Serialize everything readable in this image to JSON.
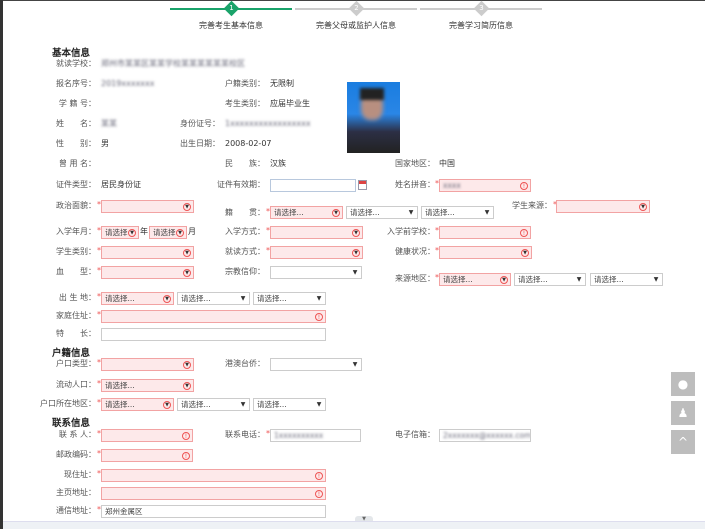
{
  "steps": [
    {
      "num": "1",
      "label": "完善考生基本信息",
      "active": true
    },
    {
      "num": "2",
      "label": "完善父母或监护人信息",
      "active": false
    },
    {
      "num": "3",
      "label": "完善学习简历信息",
      "active": false
    }
  ],
  "sections": {
    "basic": "基本信息",
    "household": "户籍信息",
    "contact": "联系信息"
  },
  "basic": {
    "school_label": "就读学校：",
    "school": "郑州市某某区某某学校某某某某某某校区",
    "reg_no_label": "报名序号：",
    "reg_no": "2019xxxxxxx",
    "hukou_type_label": "户籍类别：",
    "hukou_type": "无限制",
    "student_no_label": "学 籍 号：",
    "exam_type_label": "考生类别：",
    "exam_type": "应届毕业生",
    "name_label": "姓　　名：",
    "name": "某某",
    "id_label": "身份证号：",
    "id": "1xxxxxxxxxxxxxxxxx",
    "gender_label": "性　　别：",
    "gender": "男",
    "birth_label": "出生日期：",
    "birth": "2008-02-07",
    "former_name_label": "曾 用 名：",
    "ethnic_label": "民　　族：",
    "ethnic": "汉族",
    "country_label": "国家地区：",
    "country": "中国",
    "cert_type_label": "证件类型：",
    "cert_type": "居民身份证",
    "cert_valid_label": "证件有效期：",
    "pinyin_label": "姓名拼音：",
    "pinyin": "xxxx",
    "political_label": "政治面貌：",
    "native_label": "籍　　贯：",
    "source_label": "学生来源：",
    "enroll_label": "入学年月：",
    "year_suffix": "年",
    "month_suffix": "月",
    "enroll_mode_label": "入学方式：",
    "prev_school_label": "入学前学校：",
    "student_cat_label": "学生类别：",
    "study_mode_label": "就读方式：",
    "health_label": "健康状况：",
    "blood_label": "血　　型：",
    "religion_label": "宗教信仰：",
    "source_area_label": "来源地区：",
    "birthplace_label": "出 生 地：",
    "home_addr_label": "家庭住址：",
    "specialty_label": "特　　长："
  },
  "household": {
    "type_label": "户口类型：",
    "hmt_label": "港澳台侨：",
    "floating_label": "流动人口：",
    "area_label": "户口所在地区："
  },
  "contact": {
    "person_label": "联 系 人：",
    "phone_label": "联系电话：",
    "phone": "1xxxxxxxxxx",
    "email_label": "电子信箱：",
    "email": "2xxxxxxx@xxxxxx.com",
    "zip_label": "邮政编码：",
    "current_addr_label": "现住址：",
    "homepage_label": "主页地址：",
    "mail_addr_label": "通信地址：",
    "mail_addr": "郑州金属区"
  },
  "select_placeholder": "请选择...",
  "select_short": "请选择",
  "required_mark": "*",
  "side": {
    "wechat": "wechat-icon",
    "qq": "qq-icon",
    "top": "^"
  },
  "colors": {
    "accent": "#1aa36a",
    "required_bg": "#fde9ea",
    "required_border": "#f2a3a3"
  }
}
